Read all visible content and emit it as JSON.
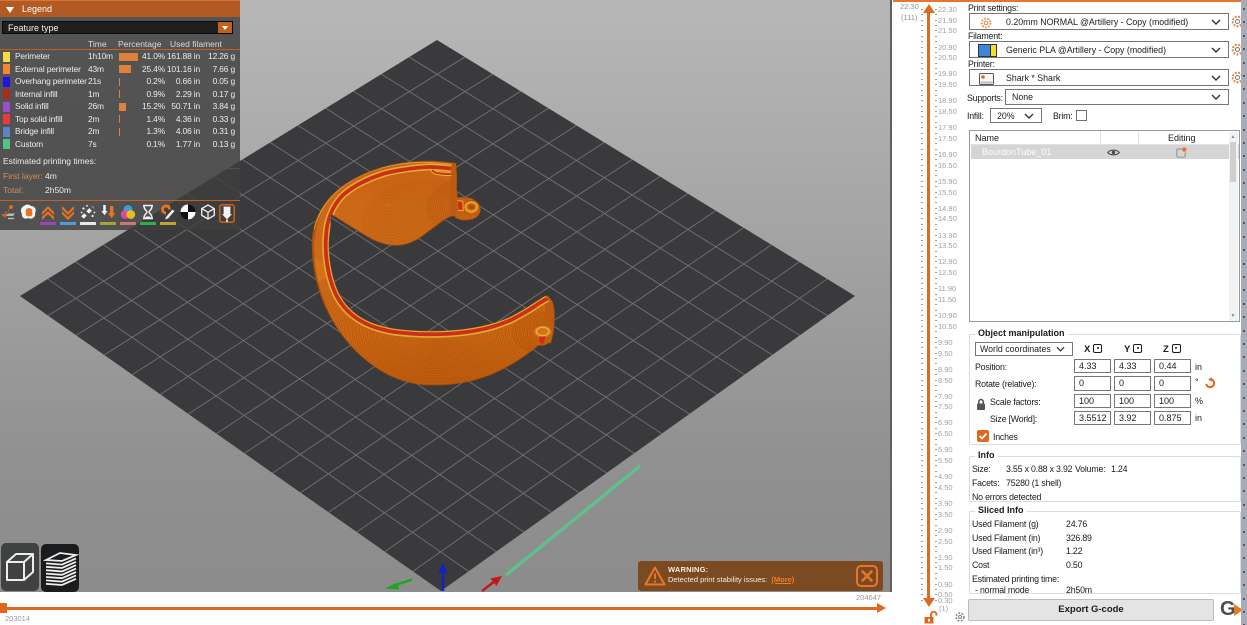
{
  "accent_color": "#ED6B21",
  "legend": {
    "title": "Legend",
    "feature_type": "Feature type",
    "columns": {
      "time": "Time",
      "percentage": "Percentage",
      "used_filament": "Used filament"
    },
    "rows": [
      {
        "name": "Perimeter",
        "color": "#f0dc4b",
        "time": "1h10m",
        "pct": "41.0%",
        "pct_num": 41.0,
        "length": "161.88 in",
        "weight": "12.26 g"
      },
      {
        "name": "External perimeter",
        "color": "#f4872f",
        "time": "43m",
        "pct": "25.4%",
        "pct_num": 25.4,
        "length": "101.16 in",
        "weight": "7.66 g"
      },
      {
        "name": "Overhang perimeter",
        "color": "#1f14e8",
        "time": "21s",
        "pct": "0.2%",
        "pct_num": 0.2,
        "length": "0.66 in",
        "weight": "0.05 g"
      },
      {
        "name": "Internal infill",
        "color": "#a92a20",
        "time": "1m",
        "pct": "0.9%",
        "pct_num": 0.9,
        "length": "2.29 in",
        "weight": "0.17 g"
      },
      {
        "name": "Solid infill",
        "color": "#9a4fc6",
        "time": "26m",
        "pct": "15.2%",
        "pct_num": 15.2,
        "length": "50.71 in",
        "weight": "3.84 g"
      },
      {
        "name": "Top solid infill",
        "color": "#ea3a3e",
        "time": "2m",
        "pct": "1.4%",
        "pct_num": 1.4,
        "length": "4.36 in",
        "weight": "0.33 g"
      },
      {
        "name": "Bridge infill",
        "color": "#5a86c0",
        "time": "2m",
        "pct": "1.3%",
        "pct_num": 1.3,
        "length": "4.06 in",
        "weight": "0.31 g"
      },
      {
        "name": "Custom",
        "color": "#55c287",
        "time": "7s",
        "pct": "0.1%",
        "pct_num": 0.1,
        "length": "1.77 in",
        "weight": "0.13 g"
      }
    ],
    "estimated_title": "Estimated printing times:",
    "first_layer_label": "First layer:",
    "first_layer_value": "4m",
    "total_label": "Total:",
    "total_value": "2h50m",
    "toggles": [
      "travel",
      "wipe",
      "retractions",
      "deretractions",
      "seams",
      "tool-changes",
      "color-changes",
      "pause-prints",
      "custom-gcodes",
      "center-of-gravity",
      "shells",
      "tool-marker"
    ]
  },
  "viewport": {
    "warning": {
      "title": "WARNING:",
      "message": "Detected print stability issues:",
      "link": "(More)"
    },
    "move_slider": {
      "min_label": "203014",
      "max_label": "204647"
    }
  },
  "layer_slider": {
    "current_value": "22.30",
    "current_layer": "(111)",
    "bottom_layer": "(1)",
    "max_mm": 22.3,
    "min_mm": 0.3,
    "layer_height": 0.2,
    "labels": [
      "22.30",
      "21.90",
      "21.50",
      "20.90",
      "20.50",
      "19.90",
      "19.50",
      "18.90",
      "18.50",
      "17.90",
      "17.50",
      "16.90",
      "16.50",
      "15.90",
      "15.50",
      "14.90",
      "14.50",
      "13.90",
      "13.50",
      "12.90",
      "12.50",
      "11.90",
      "11.50",
      "10.90",
      "10.50",
      "9.90",
      "9.50",
      "8.90",
      "8.50",
      "7.90",
      "7.50",
      "6.90",
      "6.50",
      "5.90",
      "5.50",
      "4.90",
      "4.50",
      "3.90",
      "3.50",
      "2.90",
      "2.50",
      "1.90",
      "1.50",
      "0.90",
      "0.50",
      "0.30"
    ]
  },
  "panel": {
    "print_settings_label": "Print settings:",
    "print_settings_value": "0.20mm NORMAL @Artillery - Copy (modified)",
    "filament_label": "Filament:",
    "filament_value": "Generic PLA @Artillery - Copy (modified)",
    "printer_label": "Printer:",
    "printer_value": "Shark * Shark",
    "supports_label": "Supports:",
    "supports_value": "None",
    "infill_label": "Infill:",
    "infill_value": "20%",
    "brim_label": "Brim:",
    "object_list": {
      "name_header": "Name",
      "editing_header": "Editing",
      "rows": [
        {
          "name": "BourdonTube_01"
        }
      ]
    },
    "object_manipulation": {
      "title": "Object manipulation",
      "coordinates": "World coordinates",
      "axes": [
        "X",
        "Y",
        "Z"
      ],
      "position_label": "Position:",
      "position": [
        "4.33",
        "4.33",
        "0.44"
      ],
      "position_unit": "in",
      "rotate_label": "Rotate (relative):",
      "rotate": [
        "0",
        "0",
        "0"
      ],
      "rotate_unit": "°",
      "scale_label": "Scale factors:",
      "scale": [
        "100",
        "100",
        "100"
      ],
      "scale_unit": "%",
      "size_label": "Size [World]:",
      "size": [
        "3.5512",
        "3.92",
        "0.875"
      ],
      "size_unit": "in",
      "inches_label": "Inches"
    },
    "info": {
      "title": "Info",
      "size_label": "Size:",
      "size_value": "3.55 x 0.88 x 3.92",
      "volume_label": "Volume:",
      "volume_value": "1.24",
      "facets_label": "Facets:",
      "facets_value": "75280 (1 shell)",
      "errors": "No errors detected"
    },
    "sliced_info": {
      "title": "Sliced Info",
      "rows": [
        {
          "label": "Used Filament (g)",
          "value": "24.76"
        },
        {
          "label": "Used Filament (in)",
          "value": "326.89"
        },
        {
          "label": "Used Filament (in³)",
          "value": "1.22"
        },
        {
          "label": "Cost",
          "value": "0.50"
        }
      ],
      "estimated_label": "Estimated printing time:",
      "mode_label": "- normal mode",
      "mode_value": "2h50m"
    },
    "export_label": "Export G-code"
  }
}
